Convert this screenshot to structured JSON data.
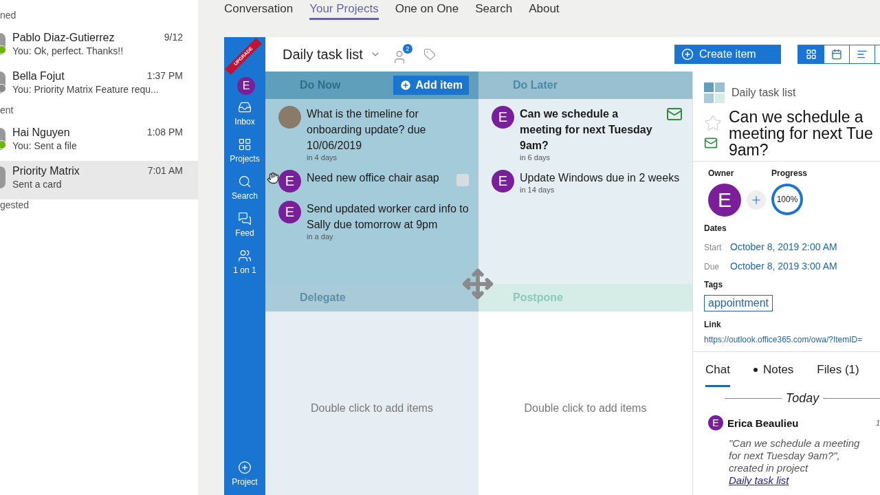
{
  "chat_list": {
    "sections": [
      {
        "heading": "ned",
        "conversations": [
          {
            "name": "Pablo Diaz-Gutierrez",
            "time": "9/12",
            "preview": "You: Ok, perfect. Thanks!!",
            "color": "#6bb700",
            "selected": false
          },
          {
            "name": "Bella Fojut",
            "time": "1:37 PM",
            "preview": "You: Priority Matrix Feature requ...",
            "color": "#8a8a8a",
            "selected": false
          }
        ]
      },
      {
        "heading": "ent",
        "conversations": [
          {
            "name": "Hai Nguyen",
            "time": "1:08 PM",
            "preview": "You: Sent a file",
            "color": "#6bb700",
            "selected": false
          },
          {
            "name": "Priority Matrix",
            "time": "7:01 AM",
            "preview": "Sent a card",
            "selected": true
          }
        ]
      },
      {
        "heading": "gested"
      }
    ]
  },
  "top_tabs": [
    {
      "label": "Conversation",
      "selected": false
    },
    {
      "label": "Your Projects",
      "selected": true
    },
    {
      "label": "One on One",
      "selected": false
    },
    {
      "label": "Search",
      "selected": false
    },
    {
      "label": "About",
      "selected": false
    }
  ],
  "rail": {
    "ribbon": "UPGRADE",
    "avatar": "E",
    "items": [
      {
        "label": "Inbox"
      },
      {
        "label": "Projects"
      },
      {
        "label": "Search"
      },
      {
        "label": "Feed"
      },
      {
        "label": "1 on 1"
      }
    ],
    "bottom_item": {
      "label": "Project"
    }
  },
  "header": {
    "title": "Daily task list",
    "members_badge": "2",
    "create_button": "Create item",
    "views": [
      {
        "selected": true
      },
      {
        "selected": false
      },
      {
        "selected": false
      },
      {
        "selected": false
      }
    ]
  },
  "quadrants": [
    {
      "title": "Do Now",
      "add_button": "Add item",
      "items": [
        {
          "title": "What is the timeline for onboarding update? due 10/06/2019",
          "due": "in 4 days",
          "has_photo": true
        },
        {
          "title": "Need new office chair asap",
          "avatar": "E",
          "checked": false
        },
        {
          "title": "Send updated worker card info to Sally due tomorrow at 9pm",
          "due": "in a day",
          "avatar": "E"
        }
      ]
    },
    {
      "title": "Do Later",
      "items": [
        {
          "title": "Can we schedule a meeting for next Tuesday 9am?",
          "due": "in 6 days",
          "avatar": "E",
          "from_email": true
        },
        {
          "title": "Update Windows due in 2 weeks",
          "due": "in 14 days",
          "avatar": "E"
        }
      ]
    },
    {
      "title": "Delegate",
      "empty_hint": "Double click to add items"
    },
    {
      "title": "Postpone",
      "empty_hint": "Double click to add items"
    }
  ],
  "detail": {
    "project": "Daily task list",
    "starred": false,
    "from_email": true,
    "title_lines": [
      "Can we schedule a",
      "meeting for next Tue",
      "9am?"
    ],
    "owner_label": "Owner",
    "owner": "E",
    "progress_label": "Progress",
    "progress": {
      "label": "100%",
      "level": 1
    },
    "dates_label": "Dates",
    "dates": [
      {
        "label": "Start",
        "value": "October 8, 2019 2:00 AM"
      },
      {
        "label": "Due",
        "value": "October 8, 2019 3:00 AM"
      }
    ],
    "tags_label": "Tags",
    "tags": [
      "appointment"
    ],
    "link_label": "Link",
    "link": "https://outlook.office365.com/owa/?ItemID=",
    "tabs": [
      {
        "label": "Chat",
        "selected": true,
        "marked": false
      },
      {
        "label": "Notes",
        "selected": false,
        "marked": true
      },
      {
        "label": "Files (1)",
        "selected": false,
        "marked": false
      }
    ],
    "day_divider": "Today",
    "message": {
      "avatar": "E",
      "author": "Erica Beaulieu",
      "time": "1",
      "text": "\"Can we schedule a meeting for next Tuesday 9am?\", created in project",
      "link": "Daily task list"
    }
  }
}
